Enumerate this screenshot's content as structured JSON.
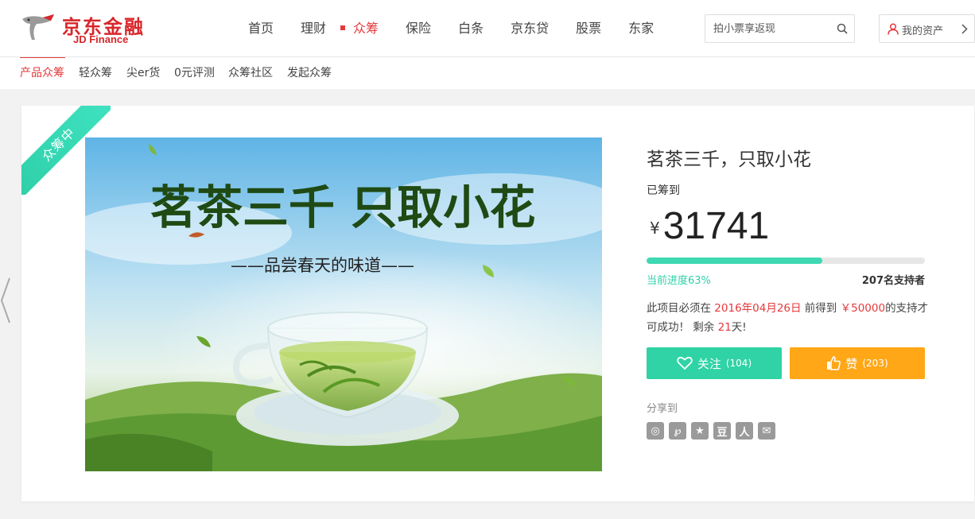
{
  "header": {
    "logo_cn": "京东金融",
    "logo_en": "JD Finance",
    "nav": [
      {
        "label": "首页"
      },
      {
        "label": "理财"
      },
      {
        "label": "众筹",
        "active": true
      },
      {
        "label": "保险"
      },
      {
        "label": "白条"
      },
      {
        "label": "京东贷"
      },
      {
        "label": "股票"
      },
      {
        "label": "东家"
      }
    ],
    "search_placeholder": "拍小票享返现",
    "assets_label": "我的资产"
  },
  "subnav": [
    {
      "label": "产品众筹",
      "active": true
    },
    {
      "label": "轻众筹"
    },
    {
      "label": "尖er货"
    },
    {
      "label": "0元评测"
    },
    {
      "label": "众筹社区"
    },
    {
      "label": "发起众筹"
    }
  ],
  "project": {
    "status_ribbon": "众筹中",
    "hero_title": "茗茶三千 只取小花",
    "hero_subtitle": "——品尝春天的味道——",
    "title": "茗茶三千，只取小花",
    "raised_label": "已筹到",
    "currency": "¥",
    "raised_amount": "31741",
    "progress_label": "当前进度63%",
    "progress_fraction": 0.63,
    "supporters": "207名支持者",
    "desc_prefix": "此项目必须在 ",
    "deadline": "2016年04月26日",
    "desc_mid": " 前得到 ",
    "goal": "￥50000",
    "desc_suffix": "的支持才可成功！ 剩余 ",
    "days_left": "21",
    "days_unit": "天!",
    "follow_label": "关注",
    "follow_count": "(104)",
    "like_label": "赞",
    "like_count": "(203)",
    "share_label": "分享到",
    "share_icons": [
      {
        "name": "weibo-icon",
        "glyph": "◎"
      },
      {
        "name": "tencent-weibo-icon",
        "glyph": "℘"
      },
      {
        "name": "qzone-icon",
        "glyph": "★"
      },
      {
        "name": "douban-icon",
        "glyph": "豆"
      },
      {
        "name": "renren-icon",
        "glyph": "人"
      },
      {
        "name": "wechat-icon",
        "glyph": "✉"
      }
    ]
  },
  "colors": {
    "brand_red": "#e4393c",
    "accent_green": "#2fd3a5",
    "like_orange": "#ffa716"
  }
}
